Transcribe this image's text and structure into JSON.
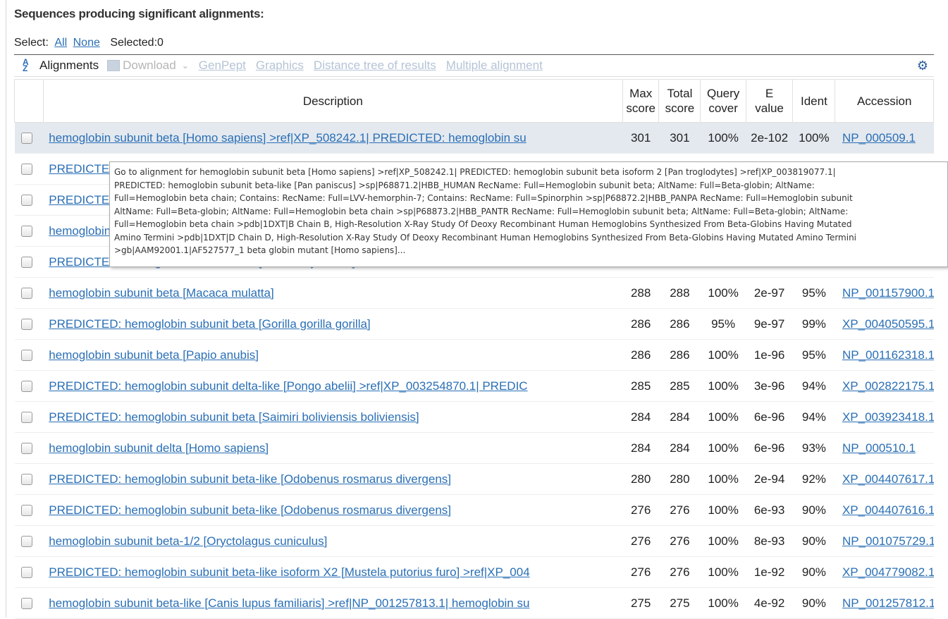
{
  "heading": "Sequences producing significant alignments:",
  "select": {
    "label": "Select:",
    "all": "All",
    "none": "None",
    "selected": "Selected:0"
  },
  "toolbar": {
    "alignments": "Alignments",
    "download": "Download",
    "links": [
      "GenPept",
      "Graphics",
      "Distance tree of results",
      "Multiple alignment"
    ],
    "icons": {
      "sort": "sort-icon",
      "download": "download-icon",
      "settings": "gear-icon"
    }
  },
  "columns": {
    "description": "Description",
    "max": [
      "Max",
      "score"
    ],
    "total": [
      "Total",
      "score"
    ],
    "query": [
      "Query",
      "cover"
    ],
    "evalue": [
      "E",
      "value"
    ],
    "ident": "Ident",
    "accession": "Accession"
  },
  "rows": [
    {
      "desc": "hemoglobin subunit beta [Homo sapiens] >ref|XP_508242.1| PREDICTED: hemoglobin su",
      "max": "301",
      "total": "301",
      "query": "100%",
      "evalue": "2e-102",
      "ident": "100%",
      "acc": "NP_000509.1",
      "highlight": true
    },
    {
      "desc": "PREDICTED: hemoglobin subunit beta isoform 2 [Pan troglodytes]",
      "max": "",
      "total": "",
      "query": "",
      "evalue": "",
      "ident": "",
      "acc": ""
    },
    {
      "desc": "PREDICTED: hemoglobin subunit beta-like [Pan paniscus]",
      "max": "",
      "total": "",
      "query": "",
      "evalue": "",
      "ident": "",
      "acc": ""
    },
    {
      "desc": "hemoglobin subunit beta [Pan troglodytes]",
      "max": "",
      "total": "",
      "query": "",
      "evalue": "",
      "ident": "",
      "acc": ""
    },
    {
      "desc": "PREDICTED: hemoglobin subunit beta [Callithrix jacchus]",
      "max": "",
      "total": "",
      "query": "",
      "evalue": "",
      "ident": "",
      "acc": ""
    },
    {
      "desc": "hemoglobin subunit beta [Macaca mulatta]",
      "max": "288",
      "total": "288",
      "query": "100%",
      "evalue": "2e-97",
      "ident": "95%",
      "acc": "NP_001157900.1"
    },
    {
      "desc": "PREDICTED: hemoglobin subunit beta [Gorilla gorilla gorilla]",
      "max": "286",
      "total": "286",
      "query": "95%",
      "evalue": "9e-97",
      "ident": "99%",
      "acc": "XP_004050595.1"
    },
    {
      "desc": "hemoglobin subunit beta [Papio anubis]",
      "max": "286",
      "total": "286",
      "query": "100%",
      "evalue": "1e-96",
      "ident": "95%",
      "acc": "NP_001162318.1"
    },
    {
      "desc": "PREDICTED: hemoglobin subunit delta-like [Pongo abelii] >ref|XP_003254870.1| PREDIC",
      "max": "285",
      "total": "285",
      "query": "100%",
      "evalue": "3e-96",
      "ident": "94%",
      "acc": "XP_002822175.1"
    },
    {
      "desc": "PREDICTED: hemoglobin subunit beta [Saimiri boliviensis boliviensis]",
      "max": "284",
      "total": "284",
      "query": "100%",
      "evalue": "6e-96",
      "ident": "94%",
      "acc": "XP_003923418.1"
    },
    {
      "desc": "hemoglobin subunit delta [Homo sapiens]",
      "max": "284",
      "total": "284",
      "query": "100%",
      "evalue": "6e-96",
      "ident": "93%",
      "acc": "NP_000510.1"
    },
    {
      "desc": "PREDICTED: hemoglobin subunit beta-like [Odobenus rosmarus divergens]",
      "max": "280",
      "total": "280",
      "query": "100%",
      "evalue": "2e-94",
      "ident": "92%",
      "acc": "XP_004407617.1"
    },
    {
      "desc": "PREDICTED: hemoglobin subunit beta-like [Odobenus rosmarus divergens]",
      "max": "276",
      "total": "276",
      "query": "100%",
      "evalue": "6e-93",
      "ident": "90%",
      "acc": "XP_004407616.1"
    },
    {
      "desc": "hemoglobin subunit beta-1/2 [Oryctolagus cuniculus]",
      "max": "276",
      "total": "276",
      "query": "100%",
      "evalue": "8e-93",
      "ident": "90%",
      "acc": "NP_001075729.1"
    },
    {
      "desc": "PREDICTED: hemoglobin subunit beta-like isoform X2 [Mustela putorius furo] >ref|XP_004",
      "max": "276",
      "total": "276",
      "query": "100%",
      "evalue": "1e-92",
      "ident": "90%",
      "acc": "XP_004779082.1"
    },
    {
      "desc": "hemoglobin subunit beta-like [Canis lupus familiaris] >ref|NP_001257813.1| hemoglobin su",
      "max": "275",
      "total": "275",
      "query": "100%",
      "evalue": "4e-92",
      "ident": "90%",
      "acc": "NP_001257812.1"
    }
  ],
  "tooltip": [
    "Go to alignment for hemoglobin subunit beta [Homo sapiens] >ref|XP_508242.1| PREDICTED: hemoglobin subunit beta isoform 2 [Pan troglodytes] >ref|XP_003819077.1|",
    "PREDICTED: hemoglobin subunit beta-like [Pan paniscus] >sp|P68871.2|HBB_HUMAN RecName: Full=Hemoglobin subunit beta; AltName: Full=Beta-globin; AltName:",
    "Full=Hemoglobin beta chain; Contains: RecName: Full=LVV-hemorphin-7; Contains: RecName: Full=Spinorphin >sp|P68872.2|HBB_PANPA RecName: Full=Hemoglobin subunit",
    "AltName: Full=Beta-globin; AltName: Full=Hemoglobin beta chain >sp|P68873.2|HBB_PANTR RecName: Full=Hemoglobin subunit beta; AltName: Full=Beta-globin; AltName:",
    "Full=Hemoglobin beta chain >pdb|1DXT|B Chain B, High-Resolution X-Ray Study Of Deoxy Recombinant Human Hemoglobins Synthesized From Beta-Globins Having Mutated",
    "Amino Termini >pdb|1DXT|D Chain D, High-Resolution X-Ray Study Of Deoxy Recombinant Human Hemoglobins Synthesized From Beta-Globins Having Mutated Amino Termini",
    ">gb|AAM92001.1|AF527577_1 beta globin mutant [Homo sapiens]..."
  ]
}
